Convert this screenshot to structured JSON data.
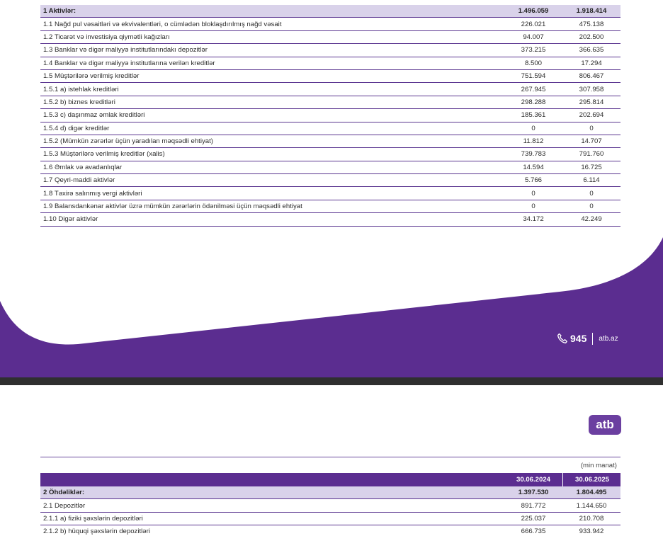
{
  "page1": {
    "rows": [
      {
        "label": "1 Aktivlər:",
        "v2024": "1.496.059",
        "v2025": "1.918.414",
        "head": true
      },
      {
        "label": "1.1 Nağd pul vəsaitləri və ekvivalentləri, o cümlədən bloklaşdırılmış nağd vəsait",
        "v2024": "226.021",
        "v2025": "475.138"
      },
      {
        "label": "1.2 Ticarət və investisiya qiymətli kağızları",
        "v2024": "94.007",
        "v2025": "202.500"
      },
      {
        "label": "1.3 Banklar və digər maliyyə institutlarındakı depozitlər",
        "v2024": "373.215",
        "v2025": "366.635"
      },
      {
        "label": "1.4 Banklar və digər maliyyə institutlarına verilən kreditlər",
        "v2024": "8.500",
        "v2025": "17.294"
      },
      {
        "label": "1.5 Müştərilərə verilmiş kreditlər",
        "v2024": "751.594",
        "v2025": "806.467"
      },
      {
        "label": "1.5.1 a) istehlak kreditləri",
        "v2024": "267.945",
        "v2025": "307.958"
      },
      {
        "label": "1.5.2 b) biznes kreditləri",
        "v2024": "298.288",
        "v2025": "295.814"
      },
      {
        "label": "1.5.3 c) daşınmaz əmlak kreditləri",
        "v2024": "185.361",
        "v2025": "202.694"
      },
      {
        "label": "1.5.4 d) digər kreditlər",
        "v2024": "0",
        "v2025": "0"
      },
      {
        "label": "1.5.2 (Mümkün zərərlər üçün yaradılan məqsədli ehtiyat)",
        "v2024": "11.812",
        "v2025": "14.707"
      },
      {
        "label": "1.5.3 Müştərilərə verilmiş kreditlər (xalis)",
        "v2024": "739.783",
        "v2025": "791.760"
      },
      {
        "label": "1.6 Əmlak və avadanlıqlar",
        "v2024": "14.594",
        "v2025": "16.725"
      },
      {
        "label": "1.7 Qeyri-maddi aktivlər",
        "v2024": "5.766",
        "v2025": "6.114"
      },
      {
        "label": "1.8 Təxirə salınmış vergi aktivləri",
        "v2024": "0",
        "v2025": "0"
      },
      {
        "label": "1.9 Balansdankənar aktivlər üzrə mümkün zərərlərin ödənilməsi üçün məqsədli ehtiyat",
        "v2024": "0",
        "v2025": "0"
      },
      {
        "label": "1.10 Digər aktivlər",
        "v2024": "34.172",
        "v2025": "42.249"
      }
    ],
    "footer": {
      "phone": "945",
      "site": "atb.az"
    }
  },
  "page2": {
    "logo": "atb",
    "unit": "(min manat)",
    "date_headers": [
      "30.06.2024",
      "30.06.2025"
    ],
    "rows": [
      {
        "label": "2 Öhdəliklər:",
        "v2024": "1.397.530",
        "v2025": "1.804.495",
        "head": true
      },
      {
        "label": "2.1 Depozitlər",
        "v2024": "891.772",
        "v2025": "1.144.650"
      },
      {
        "label": "2.1.1 a) fiziki şəxslərin depozitləri",
        "v2024": "225.037",
        "v2025": "210.708"
      },
      {
        "label": "2.1.2 b) hüquqi şəxslərin depozitləri",
        "v2024": "666.735",
        "v2025": "933.942"
      }
    ]
  },
  "colors": {
    "brand_purple": "#5b2d90",
    "header_row": "#d9d2ea",
    "separator": "#2f2f2f"
  }
}
